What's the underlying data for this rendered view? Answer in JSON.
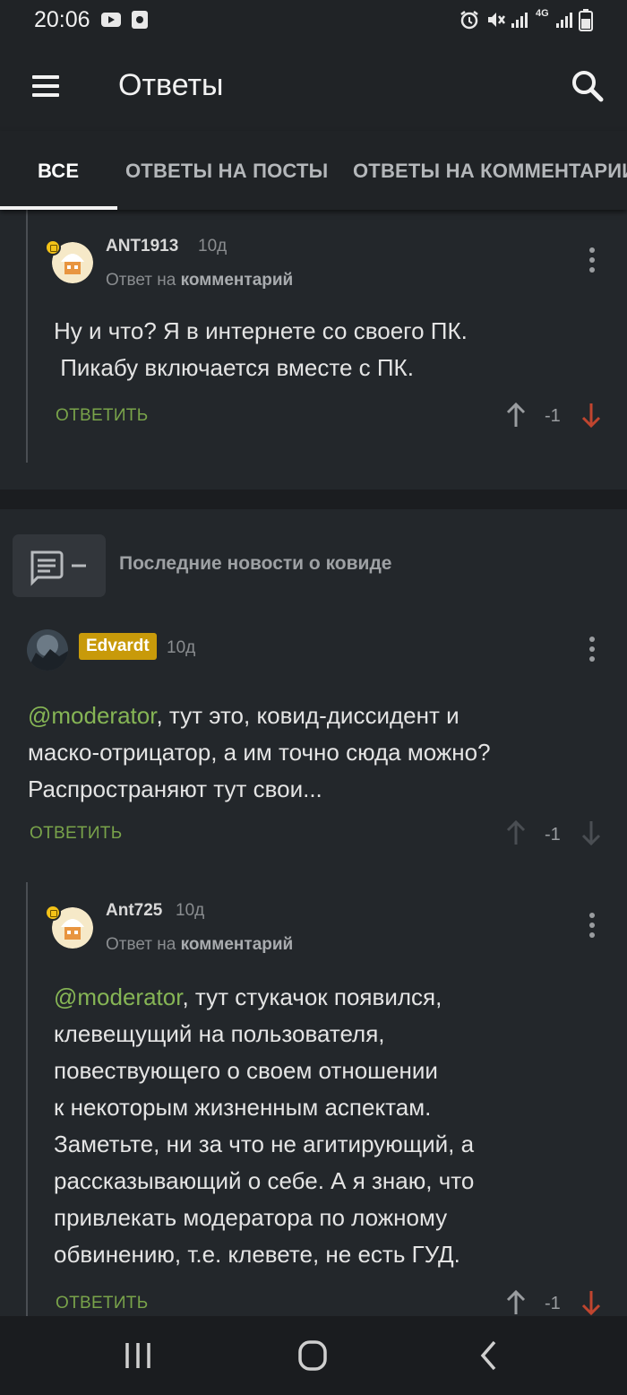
{
  "status_bar": {
    "time": "20:06",
    "network": "4G"
  },
  "app_bar": {
    "title": "Ответы",
    "icons": [
      "menu-icon",
      "search-icon"
    ]
  },
  "tabs": [
    {
      "label": "ВСЕ",
      "active": true
    },
    {
      "label": "ОТВЕТЫ НА ПОСТЫ",
      "active": false
    },
    {
      "label": "ОТВЕТЫ НА КОММЕНТАРИИ",
      "active": false
    }
  ],
  "comments": {
    "first": {
      "username": "ANT1913",
      "time": "10д",
      "reply_prefix": "Ответ на",
      "reply_target": "комментарий",
      "text_line1": "Ну и что? Я в интернете со своего ПК.",
      "text_line2": " Пикабу включается вместе с ПК.",
      "reply_label": "ОТВЕТИТЬ",
      "score": "-1",
      "voted": "down"
    },
    "post": {
      "title": "Последние новости о ковиде"
    },
    "second": {
      "username": "Edvardt",
      "time": "10д",
      "mention": "@moderator",
      "text_line1_rest": ", тут это, ковид-диссидент и",
      "text_line2": "маско-отрицатор, а им точно сюда можно?",
      "text_line3": "Распространяют тут свои...",
      "reply_label": "ОТВЕТИТЬ",
      "score": "-1",
      "voted": "none"
    },
    "third": {
      "username": "Ant725",
      "time": "10д",
      "reply_prefix": "Ответ на",
      "reply_target": "комментарий",
      "mention": "@moderator",
      "text_line1_rest": ", тут стукачок появился,",
      "text_lines": [
        "клевещущий на пользователя,",
        "повествующего о своем отношении",
        "к некоторым жизненным аспектам.",
        "Заметьте, ни за что не агитирующий, а",
        "рассказывающий о себе. А я знаю, что",
        "привлекать модератора по ложному",
        "обвинению, т.е. клевете, не есть ГУД."
      ],
      "reply_label": "ОТВЕТИТЬ",
      "score": "-1",
      "voted": "down"
    }
  },
  "colors": {
    "background": "#23272b",
    "accent_green": "#79a34a",
    "mention_green": "#86b555",
    "downvote_red": "#c0452f",
    "badge_gold": "#c89a0a"
  },
  "nav_bar": {
    "icons": [
      "recent-apps-icon",
      "home-icon",
      "back-icon"
    ]
  }
}
